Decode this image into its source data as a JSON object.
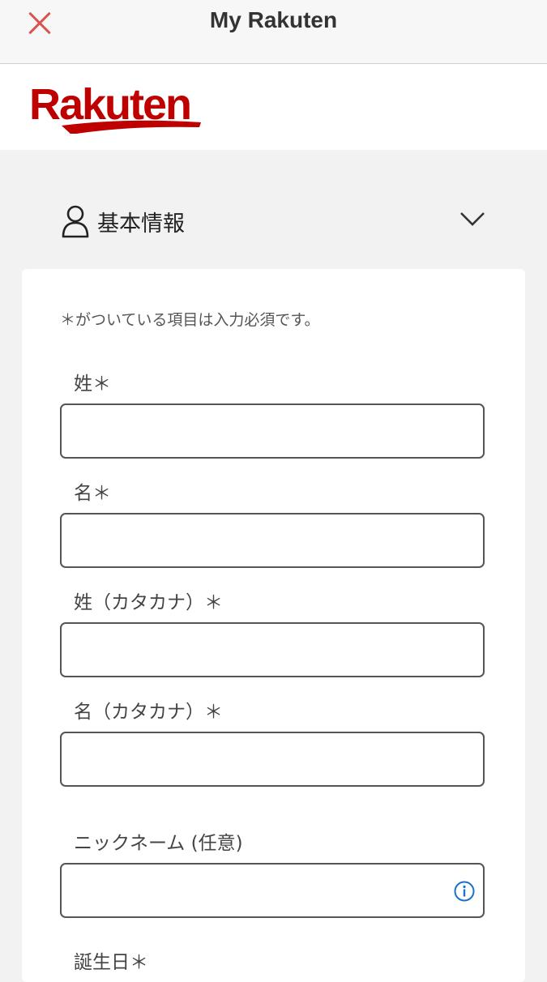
{
  "topbar": {
    "title": "My Rakuten"
  },
  "logo": {
    "text": "Rakuten",
    "color": "#bf0000"
  },
  "section": {
    "title": "基本情報"
  },
  "form": {
    "note": "＊がついている項目は入力必須です。",
    "fields": [
      {
        "label": "姓＊",
        "value": ""
      },
      {
        "label": "名＊",
        "value": ""
      },
      {
        "label": "姓（カタカナ）＊",
        "value": ""
      },
      {
        "label": "名（カタカナ）＊",
        "value": ""
      },
      {
        "label": "ニックネーム (任意)",
        "value": ""
      },
      {
        "label": "誕生日＊"
      }
    ]
  },
  "colors": {
    "accent": "#bf0000",
    "close": "#d9534f",
    "info": "#1a73c8"
  }
}
